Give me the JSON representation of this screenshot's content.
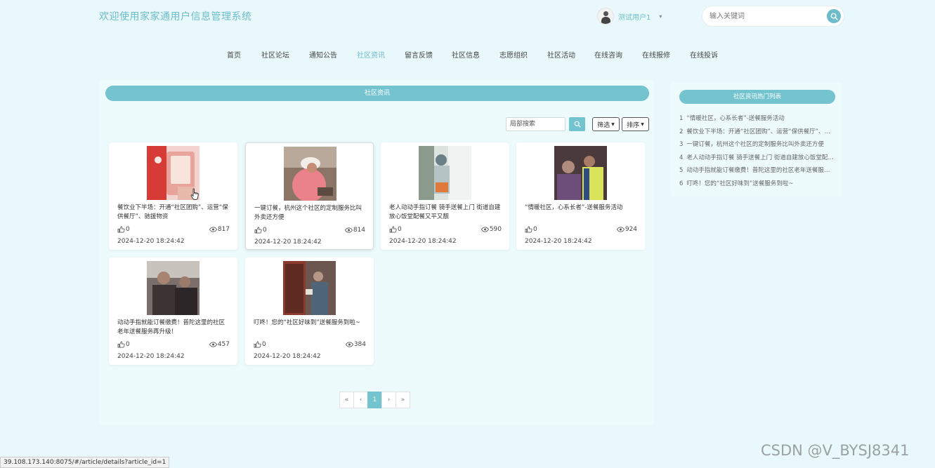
{
  "header": {
    "site_title": "欢迎使用家家通用户信息管理系统",
    "user_name": "测试用户1",
    "search_placeholder": "输入关键词"
  },
  "nav": {
    "active": "社区资讯",
    "items": [
      "首页",
      "社区论坛",
      "通知公告",
      "社区资讯",
      "留言反馈",
      "社区信息",
      "志愿组织",
      "社区活动",
      "在线咨询",
      "在线报修",
      "在线投诉"
    ]
  },
  "main": {
    "section_title": "社区资讯",
    "local_search_placeholder": "局部搜索",
    "filter_label": "筛选",
    "sort_label": "排序"
  },
  "articles": [
    {
      "title": "餐饮业下半场：开通“社区团购”、运营“保供餐厅”、驰援物资",
      "likes": "0",
      "views": "817",
      "date": "2024-12-20 18:24:42",
      "image": "red-phone-photo"
    },
    {
      "title": "一键订餐，杭州这个社区的定制服务比叫外卖还方便",
      "likes": "0",
      "views": "814",
      "date": "2024-12-20 18:24:42",
      "image": "elder-cooking-photo"
    },
    {
      "title": "老人动动手指订餐 骑手送餐上门 街道自建放心饭堂配餐又平又靓",
      "likes": "0",
      "views": "590",
      "date": "2024-12-20 18:24:42",
      "image": "meal-delivery-photo"
    },
    {
      "title": "“情暖社区，心系长者”-送餐服务活动",
      "likes": "0",
      "views": "924",
      "date": "2024-12-20 18:24:42",
      "image": "volunteer-photo"
    },
    {
      "title": "动动手指就能订餐缴费！普陀这里的社区老年送餐服务再升级！",
      "likes": "0",
      "views": "457",
      "date": "2024-12-20 18:24:42",
      "image": "elders-phone-photo"
    },
    {
      "title": "叮咚！您的“社区好味到”送餐服务到啦~",
      "likes": "0",
      "views": "384",
      "date": "2024-12-20 18:24:42",
      "image": "door-delivery-photo"
    }
  ],
  "pagination": {
    "first": "«",
    "prev": "‹",
    "current": "1",
    "next": "›",
    "last": "»"
  },
  "hot_list": {
    "title": "社区资讯热门列表",
    "items": [
      {
        "num": "1",
        "title": "“情暖社区，心系长者”-送餐服务活动"
      },
      {
        "num": "2",
        "title": "餐饮业下半场：开通“社区团购”、运营“保供餐厅”、驰援物资"
      },
      {
        "num": "3",
        "title": "一键订餐，杭州这个社区的定制服务比叫外卖还方便"
      },
      {
        "num": "4",
        "title": "老人动动手指订餐 骑手送餐上门 街道自建放心饭堂配餐又平又靓"
      },
      {
        "num": "5",
        "title": "动动手指就能订餐缴费！普陀这里的社区老年送餐服务再升级！"
      },
      {
        "num": "6",
        "title": "叮咚！您的“社区好味到”送餐服务到啦~"
      }
    ]
  },
  "status_url": "39.108.173.140:8075/#/article/details?article_id=1",
  "watermark": "CSDN @V_BYSJ8341",
  "colors": {
    "accent": "#74c4cf",
    "title": "#6cbccb",
    "background": "#e9f8fa"
  }
}
